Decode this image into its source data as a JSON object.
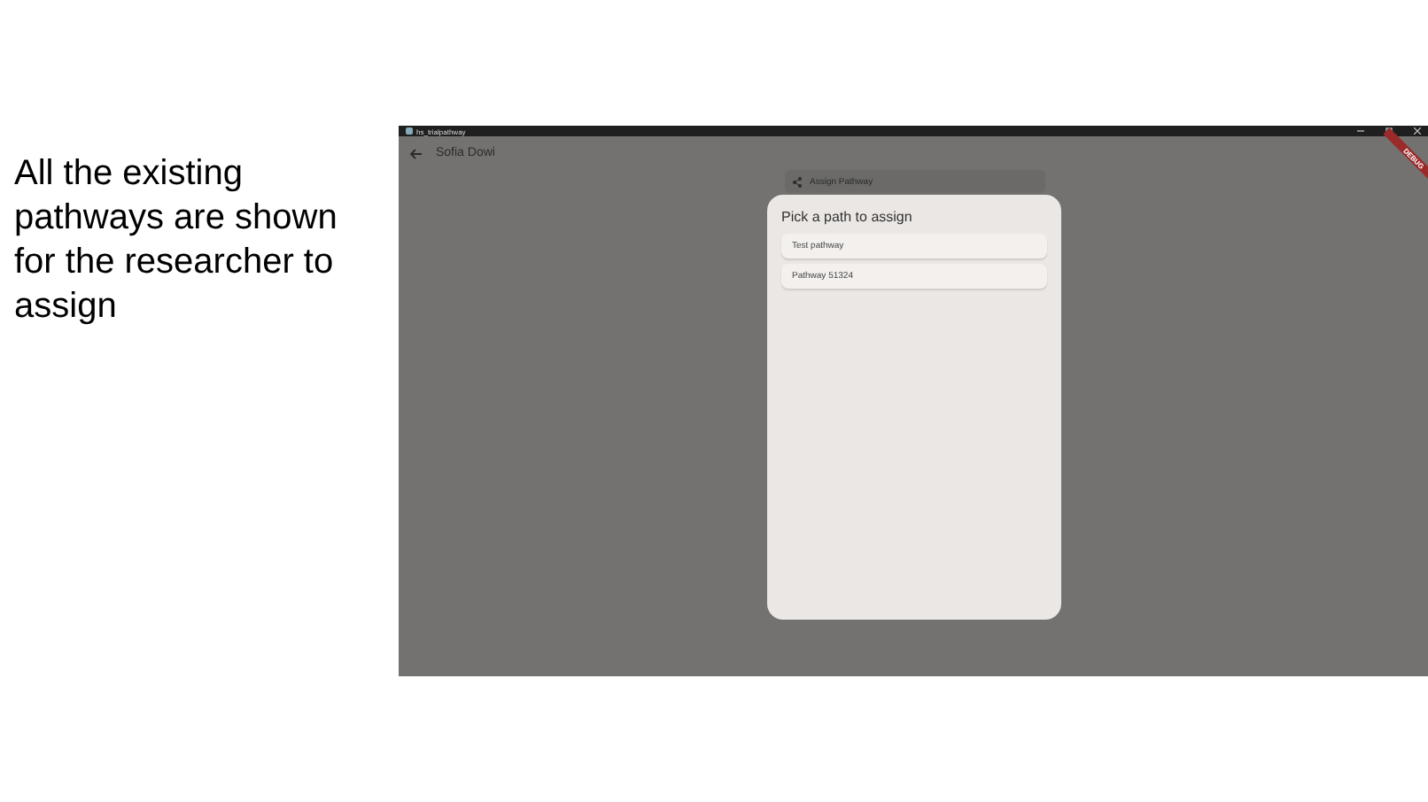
{
  "slide_text": "All the existing pathways are shown for the researcher to assign",
  "window": {
    "title": "hs_trialpathway",
    "debug_banner": "DEBUG"
  },
  "app_bar": {
    "title": "Sofia Dowi"
  },
  "assign_button": {
    "label": "Assign Pathway"
  },
  "dialog": {
    "title": "Pick a path to assign",
    "items": [
      {
        "label": "Test pathway"
      },
      {
        "label": "Pathway 51324"
      }
    ]
  }
}
